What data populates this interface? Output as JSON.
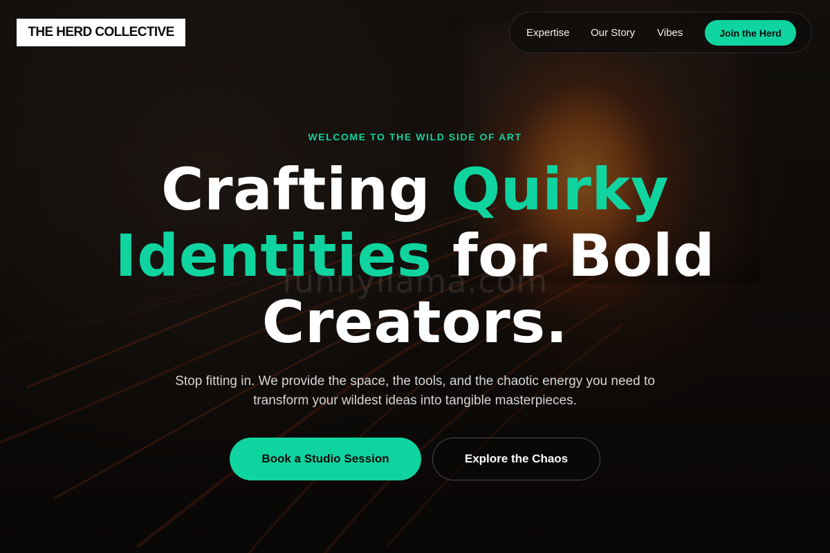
{
  "brand": {
    "logo_text": "THE HERD COLLECTIVE"
  },
  "nav": {
    "links": [
      "Expertise",
      "Our Story",
      "Vibes"
    ],
    "cta_label": "Join the Herd"
  },
  "hero": {
    "eyebrow": "WELCOME TO THE WILD SIDE OF ART",
    "headline": {
      "part1": "Crafting ",
      "accent1": "Quirky",
      "accent2": "Identities",
      "part2": " for Bold",
      "part3": "Creators."
    },
    "subtitle": "Stop fitting in. We provide the space, the tools, and the chaotic energy you need to transform your wildest ideas into tangible masterpieces.",
    "primary_button": "Book a Studio Session",
    "secondary_button": "Explore the Chaos",
    "watermark": "funnyllama.com"
  },
  "colors": {
    "accent": "#10d4a0",
    "text_primary": "#ffffff",
    "text_secondary": "#d6d6d6",
    "background": "#0d0b0a"
  }
}
